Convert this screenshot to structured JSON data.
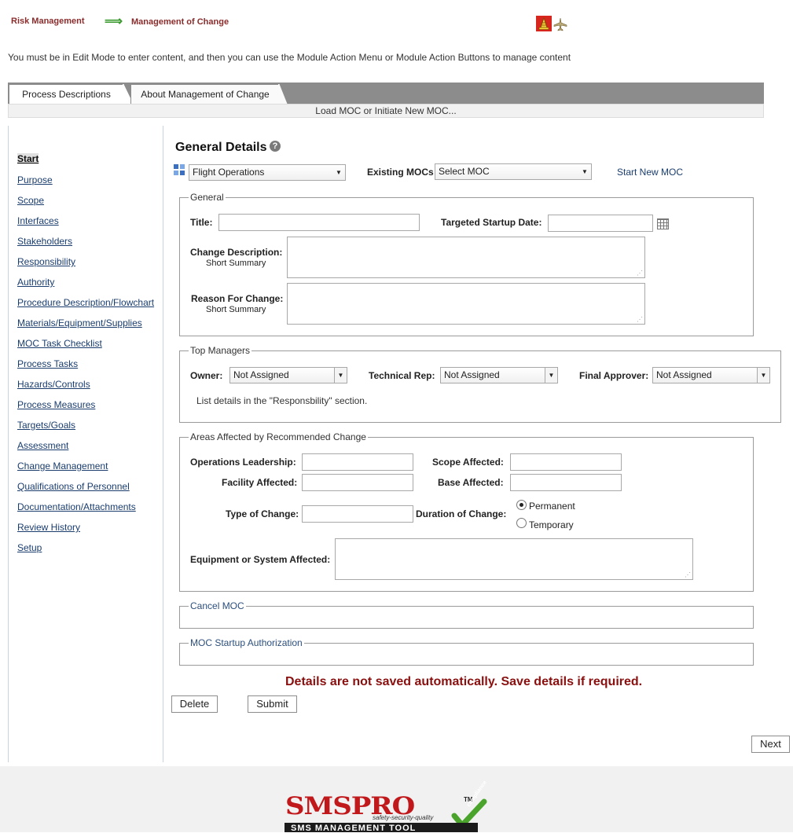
{
  "breadcrumb": {
    "root": "Risk Management",
    "arrow": "⟹",
    "current": "Management of Change"
  },
  "notice": "You must be in Edit Mode to enter content, and then you can use the Module Action Menu or Module Action Buttons to manage content",
  "tabs": [
    {
      "label": "Process Descriptions",
      "active": true
    },
    {
      "label": "About Management of Change",
      "active": false
    }
  ],
  "load_bar": "Load MOC or Initiate New MOC...",
  "sidebar": {
    "items": [
      {
        "label": "Start",
        "active": true
      },
      {
        "label": "Purpose"
      },
      {
        "label": "Scope"
      },
      {
        "label": "Interfaces"
      },
      {
        "label": "Stakeholders"
      },
      {
        "label": "Responsibility"
      },
      {
        "label": "Authority"
      },
      {
        "label": "Procedure Description/Flowchart"
      },
      {
        "label": "Materials/Equipment/Supplies"
      },
      {
        "label": "MOC Task Checklist"
      },
      {
        "label": "Process Tasks"
      },
      {
        "label": "Hazards/Controls"
      },
      {
        "label": "Process Measures"
      },
      {
        "label": "Targets/Goals"
      },
      {
        "label": "Assessment"
      },
      {
        "label": "Change Management"
      },
      {
        "label": "Qualifications of Personnel"
      },
      {
        "label": "Documentation/Attachments"
      },
      {
        "label": "Review History"
      },
      {
        "label": "Setup"
      }
    ]
  },
  "main": {
    "title": "General Details",
    "help_glyph": "?",
    "department_select": "Flight Operations",
    "existing_mocs_label": "Existing MOCs",
    "existing_mocs_select": "Select MOC",
    "start_new_moc": "Start New MOC"
  },
  "general": {
    "legend": "General",
    "title_label": "Title:",
    "title_value": "",
    "startup_label": "Targeted Startup Date:",
    "startup_value": "",
    "change_desc_label": "Change Description:",
    "change_desc_sub": "Short Summary",
    "reason_label": "Reason For Change:",
    "reason_sub": "Short Summary"
  },
  "top_managers": {
    "legend": "Top Managers",
    "owner_label": "Owner:",
    "owner_value": "Not Assigned",
    "tech_label": "Technical Rep:",
    "tech_value": "Not Assigned",
    "approver_label": "Final Approver:",
    "approver_value": "Not Assigned",
    "note": "List details in the \"Responsbility\" section."
  },
  "areas": {
    "legend": "Areas Affected by Recommended Change",
    "ops_label": "Operations Leadership:",
    "scope_label": "Scope Affected:",
    "facility_label": "Facility Affected:",
    "base_label": "Base Affected:",
    "type_label": "Type of Change:",
    "duration_label": "Duration of Change:",
    "permanent_label": "Permanent",
    "temporary_label": "Temporary",
    "duration_selected": "Permanent",
    "equipment_label": "Equipment or System Affected:"
  },
  "cancel_moc": {
    "legend": "Cancel MOC"
  },
  "startup_auth": {
    "legend": "MOC Startup Authorization"
  },
  "warning": "Details are not saved automatically. Save details if required.",
  "buttons": {
    "delete": "Delete",
    "submit": "Submit",
    "next": "Next"
  },
  "footer_logo": {
    "brand": "SMSPRO",
    "tm": "TM",
    "tagline": "safety-security-quality",
    "subtitle": "SMS MANAGEMENT TOOL",
    "badge": "compliance"
  },
  "colors": {
    "brand_red": "#c0181b",
    "check_green": "#4aa32b",
    "warning_red": "#8a0f0f",
    "crumb_red": "#8a2c2c",
    "link_blue": "#1a3d6e"
  },
  "icons": [
    "alert-bell-icon",
    "airplane-icon",
    "grid-icon",
    "help-icon",
    "calendar-icon"
  ]
}
